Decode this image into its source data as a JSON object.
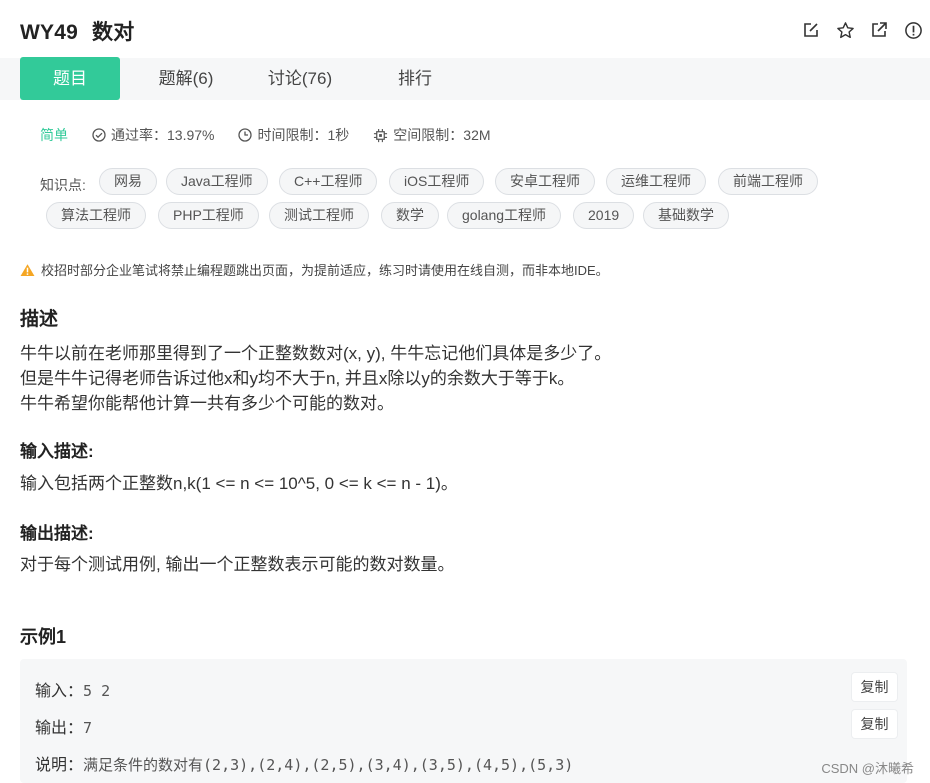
{
  "header": {
    "problem_id": "WY49",
    "problem_name": "数对",
    "icons": [
      "edit-icon",
      "star-icon",
      "external-link-icon",
      "report-icon"
    ]
  },
  "tabs": [
    {
      "label": "题目",
      "active": true
    },
    {
      "label": "题解(6)",
      "active": false
    },
    {
      "label": "讨论(76)",
      "active": false
    },
    {
      "label": "排行",
      "active": false
    }
  ],
  "meta": {
    "difficulty": "简单",
    "pass_rate": "通过率：13.97%",
    "time_limit": "时间限制：1秒",
    "space_limit": "空间限制：32M"
  },
  "knowledge": {
    "label": "知识点:",
    "tags": [
      "网易",
      "Java工程师",
      "C++工程师",
      "iOS工程师",
      "安卓工程师",
      "运维工程师",
      "前端工程师",
      "算法工程师",
      "PHP工程师",
      "测试工程师",
      "数学",
      "golang工程师",
      "2019",
      "基础数学"
    ]
  },
  "warning": "校招时部分企业笔试将禁止编程题跳出页面，为提前适应，练习时请使用在线自测，而非本地IDE。",
  "description": {
    "title": "描述",
    "lines": [
      "牛牛以前在老师那里得到了一个正整数数对(x, y), 牛牛忘记他们具体是多少了。",
      "但是牛牛记得老师告诉过他x和y均不大于n, 并且x除以y的余数大于等于k。",
      "牛牛希望你能帮他计算一共有多少个可能的数对。"
    ]
  },
  "input": {
    "title": "输入描述:",
    "text": "输入包括两个正整数n,k(1 <= n <= 10^5, 0 <= k <= n - 1)。"
  },
  "output": {
    "title": "输出描述:",
    "text": "对于每个测试用例, 输出一个正整数表示可能的数对数量。"
  },
  "example": {
    "title": "示例1",
    "input_label": "输入：",
    "input_value": "5 2",
    "output_label": "输出：",
    "output_value": "7",
    "note_label": "说明：",
    "note_value": "满足条件的数对有(2,3),(2,4),(2,5),(3,4),(3,5),(4,5),(5,3)",
    "copy_label": "复制"
  },
  "watermark": "CSDN @沐曦希",
  "colors": {
    "accent": "#32ca99",
    "warning": "#f5a623"
  }
}
